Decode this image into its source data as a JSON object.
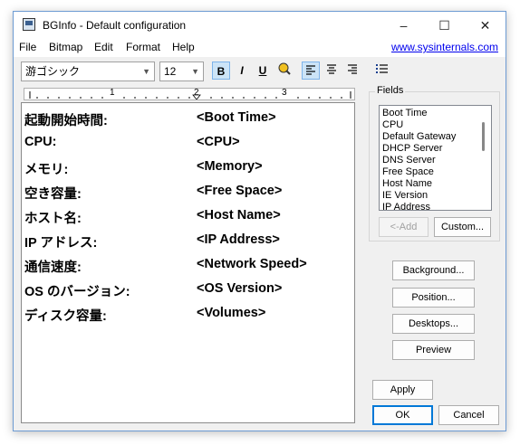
{
  "window": {
    "title": "BGInfo - Default configuration"
  },
  "menu": {
    "file": "File",
    "bitmap": "Bitmap",
    "edit": "Edit",
    "format": "Format",
    "help": "Help",
    "link": "www.sysinternals.com"
  },
  "toolbar": {
    "font": "游ゴシック",
    "size": "12",
    "bold": "B",
    "italic": "I",
    "underline": "U"
  },
  "ruler": {
    "t1": "1",
    "t2": "2",
    "t3": "3"
  },
  "editor": {
    "rows": [
      {
        "label": "起動開始時間:",
        "value": "<Boot Time>"
      },
      {
        "label": "CPU:",
        "value": "<CPU>"
      },
      {
        "label": "メモリ:",
        "value": "<Memory>"
      },
      {
        "label": "空き容量:",
        "value": "<Free Space>"
      },
      {
        "label": "ホスト名:",
        "value": "<Host Name>"
      },
      {
        "label": "IP アドレス:",
        "value": "<IP Address>"
      },
      {
        "label": "通信速度:",
        "value": "<Network Speed>"
      },
      {
        "label": "OS のバージョン:",
        "value": "<OS Version>"
      },
      {
        "label": "ディスク容量:",
        "value": "<Volumes>"
      }
    ]
  },
  "fields": {
    "label": "Fields",
    "items": [
      "Boot Time",
      "CPU",
      "Default Gateway",
      "DHCP Server",
      "DNS Server",
      "Free Space",
      "Host Name",
      "IE Version",
      "IP Address"
    ],
    "add": "<-Add",
    "custom": "Custom..."
  },
  "buttons": {
    "background": "Background...",
    "position": "Position...",
    "desktops": "Desktops...",
    "preview": "Preview",
    "apply": "Apply",
    "ok": "OK",
    "cancel": "Cancel"
  }
}
